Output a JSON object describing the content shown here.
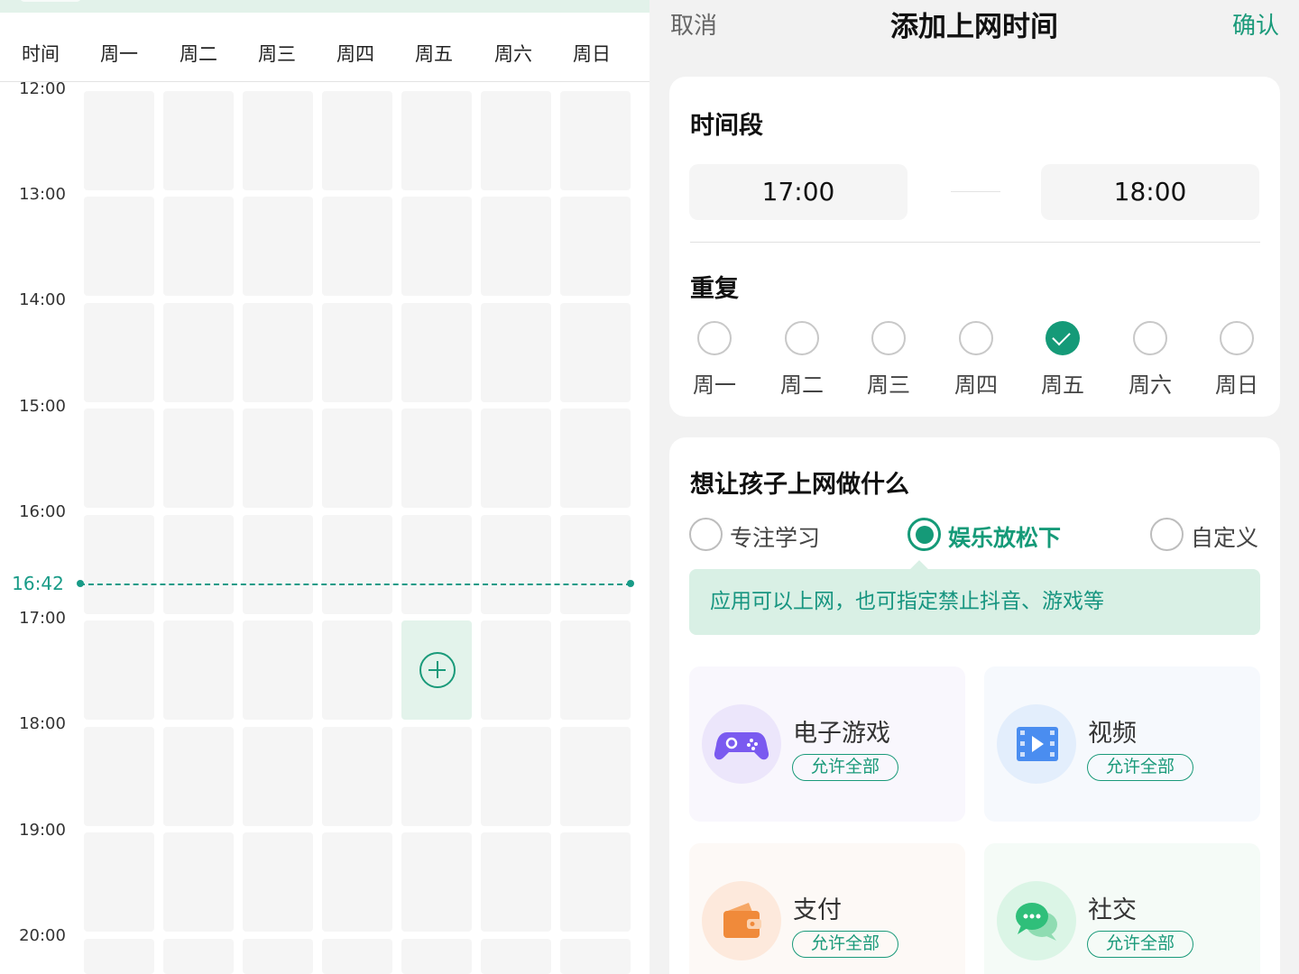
{
  "schedule": {
    "header": {
      "time_label": "时间",
      "days": [
        "周一",
        "周二",
        "周三",
        "周四",
        "周五",
        "周六",
        "周日"
      ]
    },
    "hours": [
      "12:00",
      "13:00",
      "14:00",
      "15:00",
      "16:00",
      "17:00",
      "18:00",
      "19:00",
      "20:00"
    ],
    "now": {
      "label": "16:42"
    },
    "selected_slot": {
      "day": "周五",
      "hour": "17:00"
    }
  },
  "dialog": {
    "cancel": "取消",
    "title": "添加上网时间",
    "confirm": "确认",
    "period": {
      "title": "时间段",
      "start": "17:00",
      "end": "18:00"
    },
    "repeat": {
      "title": "重复",
      "days": [
        {
          "label": "周一",
          "checked": false
        },
        {
          "label": "周二",
          "checked": false
        },
        {
          "label": "周三",
          "checked": false
        },
        {
          "label": "周四",
          "checked": false
        },
        {
          "label": "周五",
          "checked": true
        },
        {
          "label": "周六",
          "checked": false
        },
        {
          "label": "周日",
          "checked": false
        }
      ]
    },
    "purpose": {
      "title": "想让孩子上网做什么",
      "options": [
        {
          "label": "专注学习",
          "selected": false
        },
        {
          "label": "娱乐放松下",
          "selected": true
        },
        {
          "label": "自定义",
          "selected": false
        }
      ],
      "hint": "应用可以上网，也可指定禁止抖音、游戏等"
    },
    "categories": [
      {
        "name": "电子游戏",
        "action": "允许全部",
        "icon": "gamepad-icon",
        "color": "#7a5af0"
      },
      {
        "name": "视频",
        "action": "允许全部",
        "icon": "video-icon",
        "color": "#4a8df0"
      },
      {
        "name": "支付",
        "action": "允许全部",
        "icon": "wallet-icon",
        "color": "#f08a3a"
      },
      {
        "name": "社交",
        "action": "允许全部",
        "icon": "chat-icon",
        "color": "#2fbf7a"
      }
    ],
    "colors": {
      "accent": "#159a78"
    }
  }
}
